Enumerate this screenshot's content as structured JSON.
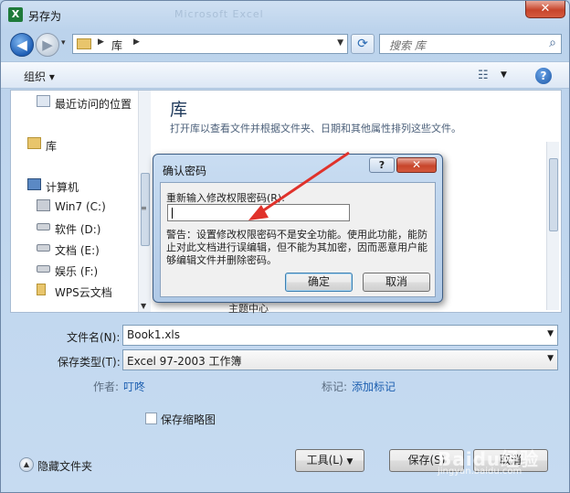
{
  "window": {
    "app_icon_glyph": "X",
    "title": "另存为",
    "ghost_title": "Microsoft Excel",
    "close_glyph": "✕"
  },
  "nav": {
    "back_glyph": "◀",
    "forward_glyph": "▶",
    "address": "库",
    "search_placeholder": "搜索 库"
  },
  "toolbar": {
    "organize_label": "组织 ▾",
    "help_glyph": "?"
  },
  "sidebar": {
    "items": [
      {
        "label": "最近访问的位置",
        "icon": "recent-places-icon"
      },
      {
        "label": "库",
        "icon": "library-icon"
      },
      {
        "label": "计算机",
        "icon": "computer-icon"
      },
      {
        "label": "Win7 (C:)",
        "icon": "drive-icon"
      },
      {
        "label": "软件 (D:)",
        "icon": "drive-icon"
      },
      {
        "label": "文档 (E:)",
        "icon": "drive-icon"
      },
      {
        "label": "娱乐 (F:)",
        "icon": "drive-icon"
      },
      {
        "label": "WPS云文档",
        "icon": "folder-icon"
      }
    ]
  },
  "content": {
    "title": "库",
    "description": "打开库以查看文件并根据文件夹、日期和其他属性排列这些文件。",
    "behind_text": "主题中心"
  },
  "form": {
    "filename_label": "文件名(N):",
    "filename_value": "Book1.xls",
    "filetype_label": "保存类型(T):",
    "filetype_value": "Excel 97-2003 工作簿",
    "author_label": "作者:",
    "author_value": "叮咚",
    "tags_label": "标记:",
    "tags_value": "添加标记",
    "thumbnail_label": "保存缩略图",
    "hide_folders_label": "隐藏文件夹",
    "tools_label": "工具(L)",
    "save_label": "保存(S)",
    "cancel_label": "取消"
  },
  "dialog": {
    "title": "确认密码",
    "help_glyph": "?",
    "close_glyph": "✕",
    "prompt": "重新输入修改权限密码(R):",
    "password_value": "",
    "warning": "警告：设置修改权限密码不是安全功能。使用此功能，能防止对此文档进行误编辑，但不能为其加密，因而恶意用户能够编辑文件并删除密码。",
    "ok_label": "确定",
    "cancel_label": "取消"
  },
  "watermark": {
    "line1": "Baidu经验",
    "line2": "jingyan.baidu.com"
  },
  "colors": {
    "annotation_arrow": "#e0322b"
  }
}
